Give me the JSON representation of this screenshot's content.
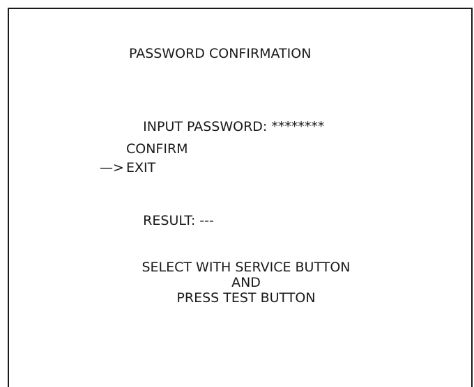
{
  "screen": {
    "title": "PASSWORD CONFIRMATION",
    "password": {
      "label": "INPUT PASSWORD:",
      "value": "********"
    },
    "menu": {
      "cursor": "—>",
      "items": [
        {
          "label": "CONFIRM",
          "selected": false
        },
        {
          "label": "EXIT",
          "selected": true
        }
      ]
    },
    "result": {
      "label": "RESULT:",
      "value": "---"
    },
    "instructions": {
      "line1": "SELECT WITH SERVICE BUTTON",
      "line2": "AND",
      "line3": "PRESS TEST BUTTON"
    }
  },
  "colors": {
    "text": "#1a1a1a",
    "background": "#ffffff",
    "border": "#1a1a1a"
  }
}
